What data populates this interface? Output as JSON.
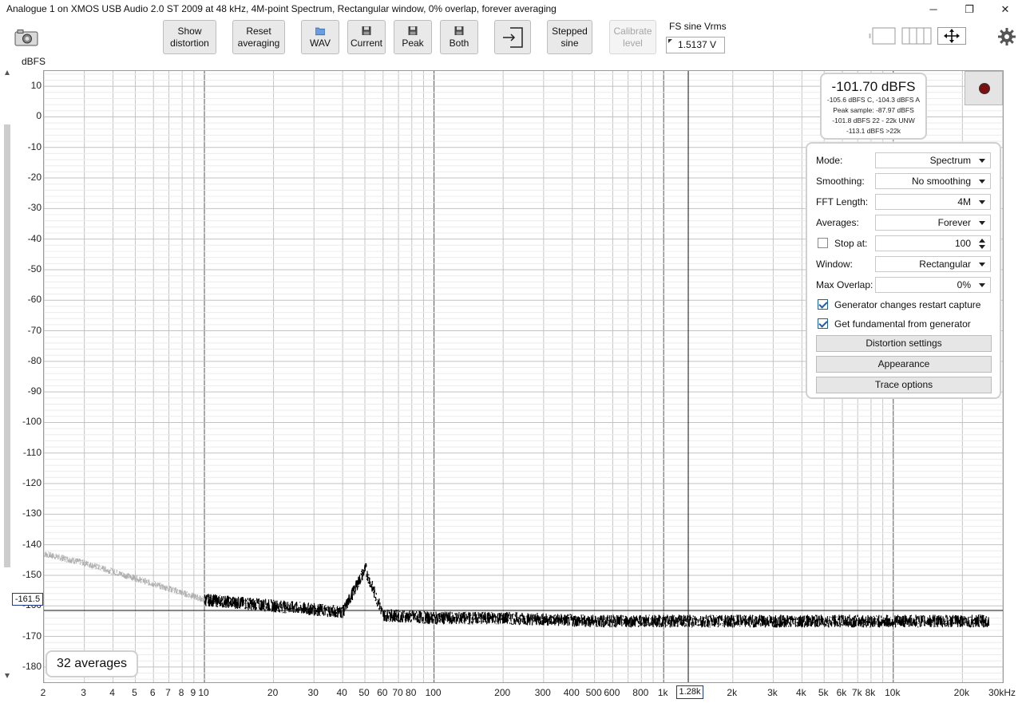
{
  "window": {
    "title": "Analogue 1 on XMOS USB Audio 2.0 ST 2009 at 48 kHz, 4M-point Spectrum, Rectangular window, 0% overlap, forever averaging",
    "minimize": "─",
    "restore": "❐",
    "close": "✕"
  },
  "toolbar": {
    "show_distortion_l1": "Show",
    "show_distortion_l2": "distortion",
    "reset_averaging_l1": "Reset",
    "reset_averaging_l2": "averaging",
    "wav": "WAV",
    "current": "Current",
    "peak": "Peak",
    "both": "Both",
    "stepped_sine_l1": "Stepped",
    "stepped_sine_l2": "sine",
    "calibrate_level_l1": "Calibrate",
    "calibrate_level_l2": "level",
    "fs_sine_label": "FS sine Vrms",
    "fs_sine_value": "1.5137 V"
  },
  "graph": {
    "y_unit": "dBFS",
    "y_ticks": [
      "10",
      "0",
      "-10",
      "-20",
      "-30",
      "-40",
      "-50",
      "-60",
      "-70",
      "-80",
      "-90",
      "-100",
      "-110",
      "-120",
      "-130",
      "-140",
      "-150",
      "-160",
      "-170",
      "-180"
    ],
    "x_ticks": [
      "2",
      "3",
      "4",
      "5",
      "6",
      "7",
      "8",
      "9",
      "10",
      "20",
      "30",
      "40",
      "50",
      "60",
      "70",
      "80",
      "100",
      "200",
      "300",
      "400",
      "500",
      "600",
      "800",
      "1k",
      "2k",
      "3k",
      "4k",
      "5k",
      "6k",
      "7k",
      "8k",
      "10k",
      "20k",
      "30kHz"
    ],
    "cursor_y_label": "-161.5",
    "cursor_x_label": "1.28k",
    "averages_label": "32 averages"
  },
  "readout": {
    "main": "-101.70 dBFS",
    "line1": "-105.6 dBFS C, -104.3 dBFS A",
    "line2": "Peak sample: -87.97 dBFS",
    "line3": "-101.8 dBFS 22 - 22k UNW",
    "line4": "-113.1 dBFS >22k"
  },
  "panel": {
    "mode_label": "Mode:",
    "mode_value": "Spectrum",
    "smoothing_label": "Smoothing:",
    "smoothing_value": "No smoothing",
    "fft_label": "FFT Length:",
    "fft_value": "4M",
    "averages_label": "Averages:",
    "averages_value": "Forever",
    "stop_at_label": "Stop at:",
    "stop_at_value": "100",
    "window_label": "Window:",
    "window_value": "Rectangular",
    "overlap_label": "Max Overlap:",
    "overlap_value": "0%",
    "gen_restart_label": "Generator changes restart capture",
    "gen_fund_label": "Get fundamental from generator",
    "distortion_settings": "Distortion settings",
    "appearance": "Appearance",
    "trace_options": "Trace options"
  },
  "chart_data": {
    "type": "line",
    "title": "",
    "xlabel": "",
    "ylabel": "dBFS",
    "x_scale": "log",
    "xlim": [
      2,
      30000
    ],
    "ylim": [
      -185,
      15
    ],
    "cursor": {
      "x": 1280,
      "y": -161.5
    },
    "series": [
      {
        "color": "#000000",
        "x": [
          10,
          20,
          40,
          50,
          60,
          100,
          200,
          500,
          1000,
          2000,
          5000,
          10000,
          20000,
          26000
        ],
        "y": [
          -158,
          -160,
          -162,
          -148,
          -163,
          -164,
          -164,
          -165,
          -165,
          -165,
          -165,
          -165,
          -165,
          -165
        ]
      },
      {
        "color": "#b0b0b0",
        "x": [
          2,
          3,
          5,
          10
        ],
        "y": [
          -143,
          -146,
          -151,
          -158
        ]
      }
    ]
  }
}
